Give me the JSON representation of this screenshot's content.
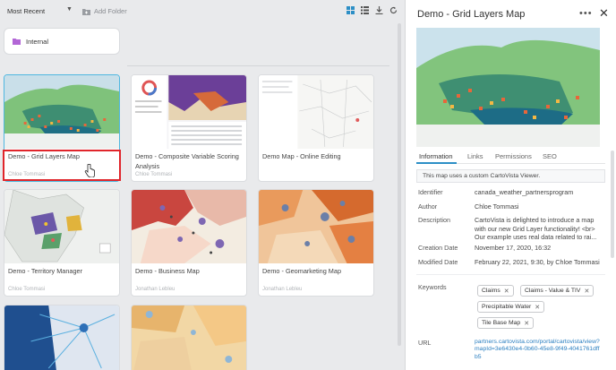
{
  "toolbar": {
    "sort_label": "Most Recent",
    "add_folder_label": "Add Folder",
    "icons": [
      "grid-view-icon",
      "list-view-icon",
      "download-icon",
      "refresh-icon"
    ]
  },
  "folder": {
    "label": "Internal",
    "color": "#b266d6"
  },
  "cards": [
    {
      "title": "Demo - Grid Layers Map",
      "author": "Chloe Tommasi"
    },
    {
      "title": "Demo - Composite Variable Scoring Analysis",
      "author": "Chloe Tommasi"
    },
    {
      "title": "Demo Map - Online Editing",
      "author": ""
    },
    {
      "title": "Demo - Territory Manager",
      "author": "Chloe Tommasi"
    },
    {
      "title": "Demo - Business Map",
      "author": "Jonathan Lebleu"
    },
    {
      "title": "Demo - Geomarketing Map",
      "author": "Jonathan Lebleu"
    }
  ],
  "detail": {
    "title": "Demo - Grid Layers Map",
    "tabs": [
      "Information",
      "Links",
      "Permissions",
      "SEO"
    ],
    "active_tab": "Information",
    "note": "This map uses a custom CartoVista Viewer.",
    "fields": {
      "identifier_label": "Identifier",
      "identifier": "canada_weather_partnersprogram",
      "author_label": "Author",
      "author": "Chloe Tommasi",
      "description_label": "Description",
      "description": "CartoVista is delighted to introduce a map with our new Grid Layer functionality! <br> Our example uses real data related to rai...",
      "creation_label": "Creation Date",
      "creation": "November 17, 2020, 16:32",
      "modified_label": "Modified Date",
      "modified": "February 22, 2021, 9:30, by Chloe Tommasi",
      "keywords_label": "Keywords",
      "url_label": "URL",
      "url": "partners.cartovista.com/portal/cartovista/view?mapId=3e6430e4-0b60-45e8-9f49-4041761dffb5"
    },
    "keywords": [
      "Claims",
      "Claims - Value & TIV",
      "Precipitable Water",
      "Tile Base Map"
    ]
  },
  "colors": {
    "accent": "#2d8fc6",
    "highlight": "#e0252b",
    "selected_border": "#4fb7e0"
  }
}
